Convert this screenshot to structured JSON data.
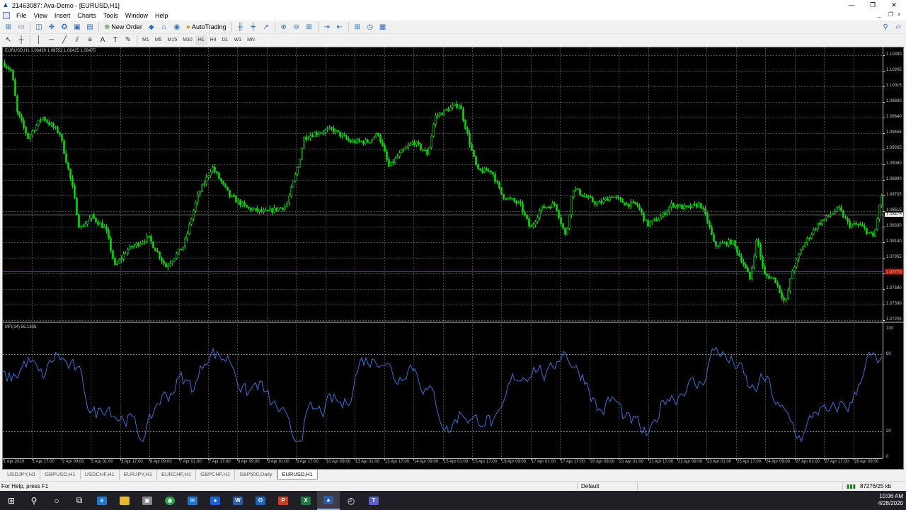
{
  "window": {
    "title": "21463087: Ava-Demo - [EURUSD,H1]",
    "controls": [
      "—",
      "❐",
      "✕"
    ]
  },
  "menu": [
    "File",
    "View",
    "Insert",
    "Charts",
    "Tools",
    "Window",
    "Help"
  ],
  "toolbar": {
    "new_order_label": "New Order",
    "autotrading_label": "AutoTrading",
    "timeframes": [
      "M1",
      "M5",
      "M15",
      "M30",
      "H1",
      "H4",
      "D1",
      "W1",
      "MN"
    ],
    "active_timeframe": "H1"
  },
  "chart": {
    "symbol_info": "EURUSD,H1  1.08430 1.08552 1.08425 1.08475",
    "price_labels": [
      "1.10390",
      "1.10205",
      "1.10015",
      "1.09830",
      "1.09640",
      "1.09455",
      "1.09265",
      "1.09080",
      "1.08890",
      "1.08705",
      "1.08515",
      "1.08330",
      "1.08140",
      "1.07955",
      "1.07770",
      "1.07580",
      "1.07390",
      "1.07205"
    ],
    "current_price": "1.08475",
    "indicator_info": "MFI(14) 56.1836",
    "indicator_levels": [
      "100",
      "80",
      "20",
      "0"
    ],
    "time_labels": [
      "1 Apr 2020",
      "1 Apr 17:00",
      "2 Apr 09:00",
      "3 Apr 01:00",
      "3 Apr 17:00",
      "6 Apr 09:00",
      "7 Apr 01:00",
      "7 Apr 17:00",
      "8 Apr 09:00",
      "9 Apr 01:00",
      "9 Apr 17:00",
      "10 Apr 09:00",
      "13 Apr 01:00",
      "13 Apr 17:00",
      "14 Apr 09:00",
      "15 Apr 01:00",
      "15 Apr 17:00",
      "16 Apr 09:00",
      "17 Apr 01:00",
      "17 Apr 17:00",
      "20 Apr 09:00",
      "21 Apr 01:00",
      "21 Apr 17:00",
      "22 Apr 09:00",
      "23 Apr 01:00",
      "23 Apr 17:00",
      "24 Apr 09:00",
      "27 Apr 01:00",
      "27 Apr 17:00",
      "28 Apr 09:00"
    ],
    "colors": {
      "candles": "#00e000",
      "mfi_line": "#3b6fd8",
      "grid": "#4a4a4a",
      "price_line": "#c8c8c8",
      "level_line": "#c01010"
    }
  },
  "tabs": [
    "USDJPY,H1",
    "GBPUSD,H1",
    "USDCHF,H1",
    "EURJPY,H1",
    "EURCHF,H1",
    "GBPCHF,H1",
    "S&P500,Daily",
    "EURUSD,H1"
  ],
  "active_tab": "EURUSD,H1",
  "status": {
    "help": "For Help, press F1",
    "profile": "Default",
    "traffic": "87276/25 kb"
  },
  "taskbar": {
    "time": "10:06 AM",
    "date": "4/28/2020"
  }
}
